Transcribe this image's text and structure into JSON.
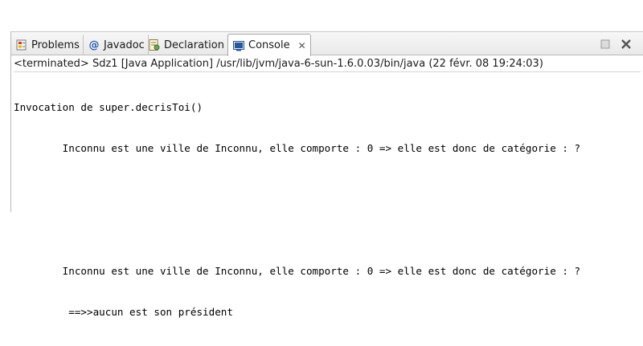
{
  "tabs": [
    {
      "label": "Problems",
      "icon": "problems-icon",
      "active": false
    },
    {
      "label": "Javadoc",
      "icon": "javadoc-at-icon",
      "active": false
    },
    {
      "label": "Declaration",
      "icon": "declaration-icon",
      "active": false
    },
    {
      "label": "Console",
      "icon": "console-icon",
      "active": true,
      "close": "✕"
    }
  ],
  "status": "<terminated> Sdz1 [Java Application] /usr/lib/jvm/java-6-sun-1.6.0.03/bin/java (22 févr. 08 19:24:03)",
  "console_lines": [
    "Invocation de super.decrisToi()",
    "        Inconnu est une ville de Inconnu, elle comporte : 0 => elle est donc de catégorie : ?",
    "",
    "",
    "        Inconnu est une ville de Inconnu, elle comporte : 0 => elle est donc de catégorie : ?",
    "         ==>>aucun est son président"
  ],
  "colors": {
    "accent": "#1e5aa8",
    "tab_bg": "#e9e9e9"
  }
}
